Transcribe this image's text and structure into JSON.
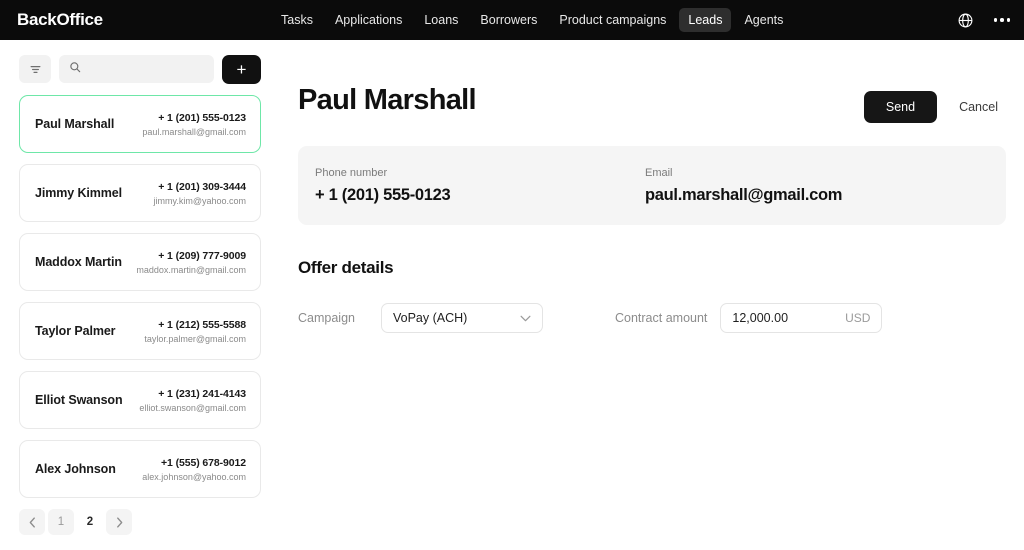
{
  "topbar": {
    "brand": "BackOffice",
    "nav": [
      {
        "label": "Tasks",
        "active": false
      },
      {
        "label": "Applications",
        "active": false
      },
      {
        "label": "Loans",
        "active": false
      },
      {
        "label": "Borrowers",
        "active": false
      },
      {
        "label": "Product campaigns",
        "active": false
      },
      {
        "label": "Leads",
        "active": true
      },
      {
        "label": "Agents",
        "active": false
      }
    ],
    "globe_icon": "globe-icon",
    "more_icon": "more-options-icon"
  },
  "sidebar": {
    "filter_icon": "filter-icon",
    "search": {
      "icon": "search-icon",
      "value": "",
      "placeholder": ""
    },
    "add_button_label": "+",
    "leads": [
      {
        "name": "Paul Marshall",
        "phone": "+ 1 (201) 555-0123",
        "email": "paul.marshall@gmail.com",
        "selected": true
      },
      {
        "name": "Jimmy Kimmel",
        "phone": "+ 1 (201) 309-3444",
        "email": "jimmy.kim@yahoo.com",
        "selected": false
      },
      {
        "name": "Maddox Martin",
        "phone": "+ 1 (209) 777-9009",
        "email": "maddox.martin@gmail.com",
        "selected": false
      },
      {
        "name": "Taylor Palmer",
        "phone": "+ 1 (212) 555-5588",
        "email": "taylor.palmer@gmail.com",
        "selected": false
      },
      {
        "name": "Elliot Swanson",
        "phone": "+ 1 (231) 241-4143",
        "email": "elliot.swanson@gmail.com",
        "selected": false
      },
      {
        "name": "Alex Johnson",
        "phone": "+1 (555) 678-9012",
        "email": "alex.johnson@yahoo.com",
        "selected": false
      }
    ],
    "pagination": {
      "prev_icon": "chevron-left-icon",
      "next_icon": "chevron-right-icon",
      "pages": [
        "1",
        "2"
      ],
      "current": "2"
    }
  },
  "main": {
    "title": "Paul Marshall",
    "send_label": "Send",
    "cancel_label": "Cancel",
    "info": {
      "phone_label": "Phone number",
      "phone_value": "+ 1 (201) 555-0123",
      "email_label": "Email",
      "email_value": "paul.marshall@gmail.com"
    },
    "offer": {
      "section_title": "Offer details",
      "campaign_label": "Campaign",
      "campaign_value": "VoPay (ACH)",
      "campaign_chevron": "chevron-down-icon",
      "amount_label": "Contract amount",
      "amount_value": "12,000.00",
      "amount_currency": "USD"
    }
  },
  "colors": {
    "topbar_bg": "#0b0b0b",
    "accent_selected_border": "#6ee7a8",
    "card_bg": "#f5f5f5",
    "primary_button": "#161616"
  }
}
